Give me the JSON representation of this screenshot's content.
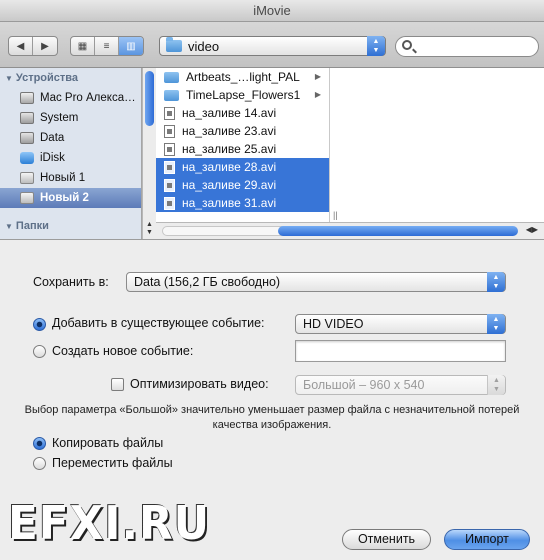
{
  "window": {
    "title": "iMovie"
  },
  "toolbar": {
    "back_forward": [
      "◀",
      "▶"
    ],
    "view_modes": [
      "icon-view",
      "list-view",
      "column-view"
    ],
    "active_view": "column-view",
    "path_popup": "video",
    "search_placeholder": ""
  },
  "sidebar": {
    "sections": [
      {
        "title": "Устройства",
        "items": [
          {
            "label": "Mac Pro Алекса…",
            "icon": "mac-icon"
          },
          {
            "label": "System",
            "icon": "disk-icon"
          },
          {
            "label": "Data",
            "icon": "disk-icon"
          },
          {
            "label": "iDisk",
            "icon": "idisk-icon"
          },
          {
            "label": "Новый 1",
            "icon": "firewire-disk-icon"
          },
          {
            "label": "Новый 2",
            "icon": "firewire-disk-icon",
            "selected": true
          }
        ]
      },
      {
        "title": "Папки",
        "items": [
          {
            "label": "",
            "icon": "folder-icon"
          }
        ]
      }
    ]
  },
  "browser": {
    "files": [
      {
        "name": "Artbeats_…light_PAL",
        "type": "folder",
        "selected": false
      },
      {
        "name": "TimeLapse_Flowers1",
        "type": "folder",
        "selected": false
      },
      {
        "name": "на_заливе 14.avi",
        "type": "file",
        "selected": false
      },
      {
        "name": "на_заливе 23.avi",
        "type": "file",
        "selected": false
      },
      {
        "name": "на_заливе 25.avi",
        "type": "file",
        "selected": false
      },
      {
        "name": "на_заливе 28.avi",
        "type": "file",
        "selected": true
      },
      {
        "name": "на_заливе 29.avi",
        "type": "file",
        "selected": true
      },
      {
        "name": "на_заливе 31.avi",
        "type": "file",
        "selected": true
      }
    ]
  },
  "options": {
    "save_to_label": "Сохранить в:",
    "save_to_value": "Data (156,2 ГБ свободно)",
    "add_existing_label": "Добавить в существующее событие:",
    "add_existing_value": "HD VIDEO",
    "create_new_label": "Создать новое событие:",
    "create_new_value": "",
    "optimize_label": "Оптимизировать видео:",
    "optimize_value": "Большой – 960 x 540",
    "optimize_note": "Выбор параметра «Большой» значительно уменьшает размер файла с незначительной потерей качества изображения.",
    "copy_label": "Копировать файлы",
    "move_label": "Переместить файлы"
  },
  "buttons": {
    "cancel": "Отменить",
    "import": "Импорт"
  },
  "watermark": "EFXI.RU",
  "colors": {
    "selection": "#3875d7",
    "accent": "#4f8fe5"
  }
}
